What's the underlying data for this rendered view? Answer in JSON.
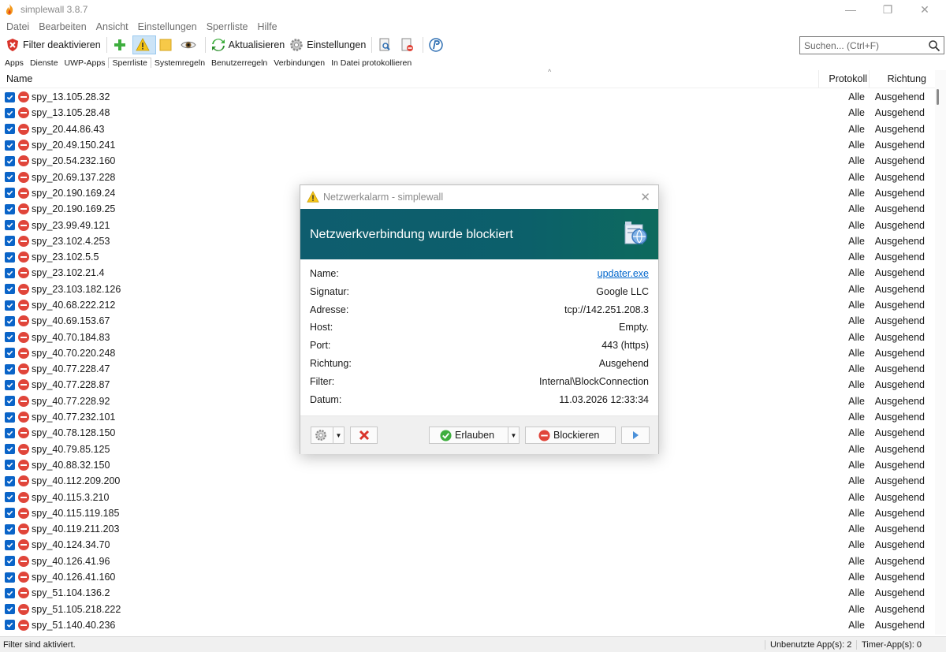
{
  "window": {
    "title": "simplewall 3.8.7",
    "minimize": "—",
    "maximize": "❐",
    "close": "✕"
  },
  "menu": [
    "Datei",
    "Bearbeiten",
    "Ansicht",
    "Einstellungen",
    "Sperrliste",
    "Hilfe"
  ],
  "toolbar": {
    "filter_label": "Filter deaktivieren",
    "refresh_label": "Aktualisieren",
    "settings_label": "Einstellungen",
    "search_placeholder": "Suchen... (Ctrl+F)"
  },
  "tabs": [
    "Apps",
    "Dienste",
    "UWP-Apps",
    "Sperrliste",
    "Systemregeln",
    "Benutzerregeln",
    "Verbindungen",
    "In Datei protokollieren"
  ],
  "selected_tab": "Sperrliste",
  "columns": {
    "name": "Name",
    "protocol": "Protokoll",
    "direction": "Richtung"
  },
  "rows": [
    {
      "name": "spy_13.105.28.32",
      "protocol": "Alle",
      "direction": "Ausgehend"
    },
    {
      "name": "spy_13.105.28.48",
      "protocol": "Alle",
      "direction": "Ausgehend"
    },
    {
      "name": "spy_20.44.86.43",
      "protocol": "Alle",
      "direction": "Ausgehend"
    },
    {
      "name": "spy_20.49.150.241",
      "protocol": "Alle",
      "direction": "Ausgehend"
    },
    {
      "name": "spy_20.54.232.160",
      "protocol": "Alle",
      "direction": "Ausgehend"
    },
    {
      "name": "spy_20.69.137.228",
      "protocol": "Alle",
      "direction": "Ausgehend"
    },
    {
      "name": "spy_20.190.169.24",
      "protocol": "Alle",
      "direction": "Ausgehend"
    },
    {
      "name": "spy_20.190.169.25",
      "protocol": "Alle",
      "direction": "Ausgehend"
    },
    {
      "name": "spy_23.99.49.121",
      "protocol": "Alle",
      "direction": "Ausgehend"
    },
    {
      "name": "spy_23.102.4.253",
      "protocol": "Alle",
      "direction": "Ausgehend"
    },
    {
      "name": "spy_23.102.5.5",
      "protocol": "Alle",
      "direction": "Ausgehend"
    },
    {
      "name": "spy_23.102.21.4",
      "protocol": "Alle",
      "direction": "Ausgehend"
    },
    {
      "name": "spy_23.103.182.126",
      "protocol": "Alle",
      "direction": "Ausgehend"
    },
    {
      "name": "spy_40.68.222.212",
      "protocol": "Alle",
      "direction": "Ausgehend"
    },
    {
      "name": "spy_40.69.153.67",
      "protocol": "Alle",
      "direction": "Ausgehend"
    },
    {
      "name": "spy_40.70.184.83",
      "protocol": "Alle",
      "direction": "Ausgehend"
    },
    {
      "name": "spy_40.70.220.248",
      "protocol": "Alle",
      "direction": "Ausgehend"
    },
    {
      "name": "spy_40.77.228.47",
      "protocol": "Alle",
      "direction": "Ausgehend"
    },
    {
      "name": "spy_40.77.228.87",
      "protocol": "Alle",
      "direction": "Ausgehend"
    },
    {
      "name": "spy_40.77.228.92",
      "protocol": "Alle",
      "direction": "Ausgehend"
    },
    {
      "name": "spy_40.77.232.101",
      "protocol": "Alle",
      "direction": "Ausgehend"
    },
    {
      "name": "spy_40.78.128.150",
      "protocol": "Alle",
      "direction": "Ausgehend"
    },
    {
      "name": "spy_40.79.85.125",
      "protocol": "Alle",
      "direction": "Ausgehend"
    },
    {
      "name": "spy_40.88.32.150",
      "protocol": "Alle",
      "direction": "Ausgehend"
    },
    {
      "name": "spy_40.112.209.200",
      "protocol": "Alle",
      "direction": "Ausgehend"
    },
    {
      "name": "spy_40.115.3.210",
      "protocol": "Alle",
      "direction": "Ausgehend"
    },
    {
      "name": "spy_40.115.119.185",
      "protocol": "Alle",
      "direction": "Ausgehend"
    },
    {
      "name": "spy_40.119.211.203",
      "protocol": "Alle",
      "direction": "Ausgehend"
    },
    {
      "name": "spy_40.124.34.70",
      "protocol": "Alle",
      "direction": "Ausgehend"
    },
    {
      "name": "spy_40.126.41.96",
      "protocol": "Alle",
      "direction": "Ausgehend"
    },
    {
      "name": "spy_40.126.41.160",
      "protocol": "Alle",
      "direction": "Ausgehend"
    },
    {
      "name": "spy_51.104.136.2",
      "protocol": "Alle",
      "direction": "Ausgehend"
    },
    {
      "name": "spy_51.105.218.222",
      "protocol": "Alle",
      "direction": "Ausgehend"
    },
    {
      "name": "spy_51.140.40.236",
      "protocol": "Alle",
      "direction": "Ausgehend"
    }
  ],
  "status": {
    "left": "Filter sind aktiviert.",
    "unused": "Unbenutzte App(s): 2",
    "timer": "Timer-App(s): 0"
  },
  "dialog": {
    "title": "Netzwerkalarm - simplewall",
    "heading": "Netzwerkverbindung wurde blockiert",
    "fields": [
      {
        "label": "Name:",
        "value": "updater.exe"
      },
      {
        "label": "Signatur:",
        "value": "Google LLC"
      },
      {
        "label": "Adresse:",
        "value": "tcp://142.251.208.3"
      },
      {
        "label": "Host:",
        "value": "Empty."
      },
      {
        "label": "Port:",
        "value": "443 (https)"
      },
      {
        "label": "Richtung:",
        "value": "Ausgehend"
      },
      {
        "label": "Filter:",
        "value": "Internal\\BlockConnection"
      },
      {
        "label": "Datum:",
        "value": "11.03.2026 12:33:34"
      }
    ],
    "allow_label": "Erlauben",
    "block_label": "Blockieren"
  },
  "colors": {
    "accent": "#0a64c8",
    "banner": "#0e5d6e",
    "block_red": "#e0453a",
    "allow_green": "#3fae3f"
  }
}
